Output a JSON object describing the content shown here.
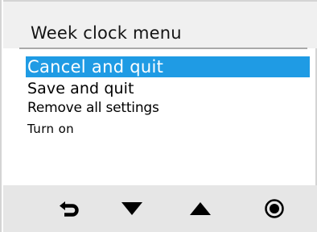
{
  "header": {
    "title": "Week clock menu"
  },
  "menu": {
    "items": [
      {
        "label": "Cancel and quit",
        "selected": true
      },
      {
        "label": "Save and quit",
        "selected": false
      },
      {
        "label": "Remove all settings",
        "selected": false
      },
      {
        "label": "Turn on",
        "selected": false
      }
    ]
  },
  "footer": {
    "buttons": [
      {
        "icon": "back-arrow-icon"
      },
      {
        "icon": "triangle-down-icon"
      },
      {
        "icon": "triangle-up-icon"
      },
      {
        "icon": "radio-dot-icon"
      }
    ]
  },
  "colors": {
    "selection": "#1f9be4",
    "header_bg": "#f0f0f0",
    "footer_bg": "#e6e6e6",
    "text": "#000000"
  }
}
